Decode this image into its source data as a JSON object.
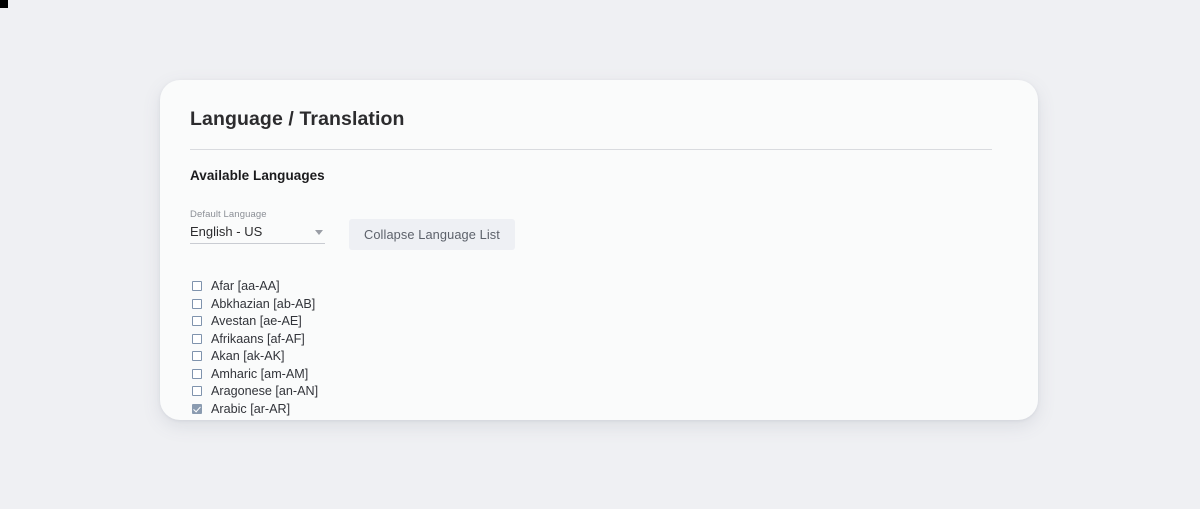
{
  "card": {
    "title": "Language / Translation",
    "section_heading": "Available Languages"
  },
  "default_language_select": {
    "label": "Default Language",
    "value": "English - US",
    "caret_icon": "chevron-down-icon"
  },
  "collapse_button": {
    "label": "Collapse Language List"
  },
  "languages": [
    {
      "label": "Afar [aa-AA]",
      "checked": false
    },
    {
      "label": "Abkhazian [ab-AB]",
      "checked": false
    },
    {
      "label": "Avestan [ae-AE]",
      "checked": false
    },
    {
      "label": "Afrikaans [af-AF]",
      "checked": false
    },
    {
      "label": "Akan [ak-AK]",
      "checked": false
    },
    {
      "label": "Amharic [am-AM]",
      "checked": false
    },
    {
      "label": "Aragonese [an-AN]",
      "checked": false
    },
    {
      "label": "Arabic [ar-AR]",
      "checked": true
    }
  ],
  "colors": {
    "page_background": "#eff0f3",
    "card_background": "#fafbfb",
    "title_text": "#2c2c2e",
    "checkbox_border": "#7f93ad",
    "checkbox_checked_fill": "#8a9bb0",
    "button_background": "#eef0f4",
    "button_text": "#5d626b"
  }
}
